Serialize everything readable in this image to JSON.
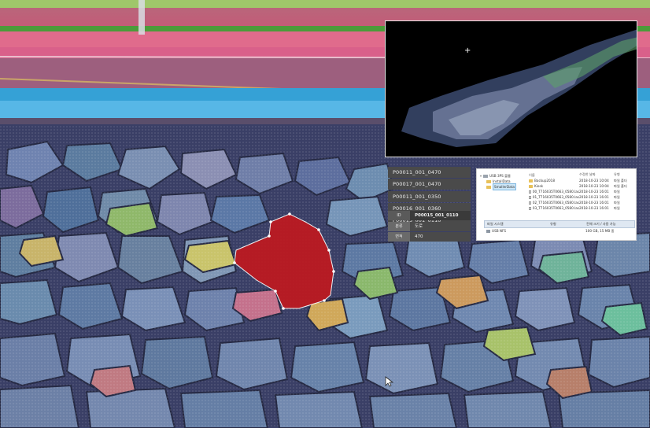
{
  "inset_view": {
    "crosshair": "crosshair-icon"
  },
  "segments": [
    "P00011_001_0470",
    "P00017_001_0470",
    "P00011_001_0350",
    "P00016_001_0360",
    "P00015_001_0110"
  ],
  "properties": {
    "header": {
      "key": "ID",
      "value": "P00015_001_0110"
    },
    "rows": [
      {
        "key": "분류",
        "value": "도로"
      },
      {
        "key": "면적",
        "value": "470"
      }
    ]
  },
  "explorer": {
    "tree": [
      {
        "label": "USB 3PS 볼륨",
        "level": 0,
        "icon": "drive-icon"
      },
      {
        "label": "InstallData",
        "level": 1,
        "icon": "folder-icon"
      },
      {
        "label": "SmallerData",
        "level": 1,
        "icon": "folder-icon",
        "selected": true
      }
    ],
    "columns": {
      "name": "이름",
      "date": "수정한 날짜",
      "type": "유형"
    },
    "files": [
      {
        "name": "Backup2018",
        "date": "2018-10-23 10:04",
        "type": "파일 폴더",
        "icon": "folder-icon"
      },
      {
        "name": "Kiosk",
        "date": "2018-10-23 10:04",
        "type": "파일 폴더",
        "icon": "folder-icon"
      },
      {
        "name": "00_T716035T0663_0580.las",
        "date": "2018-10-23 16:01",
        "type": "파일",
        "icon": "file-icon"
      },
      {
        "name": "01_T716035T0663_0580.las",
        "date": "2018-10-23 16:01",
        "type": "파일",
        "icon": "file-icon"
      },
      {
        "name": "02_T716035T0663_0580.las",
        "date": "2018-10-23 16:01",
        "type": "파일",
        "icon": "file-icon"
      },
      {
        "name": "03_T716035T0663_0580.las",
        "date": "2018-10-23 16:01",
        "type": "파일",
        "icon": "file-icon"
      }
    ],
    "footer": {
      "columns": {
        "name": "파일 시스템",
        "type": "유형",
        "free": "전체 크기 / 사용 가능"
      },
      "row": {
        "name": "USB NFS",
        "type": "",
        "free": "100 GB, 15 MB 중"
      }
    }
  }
}
